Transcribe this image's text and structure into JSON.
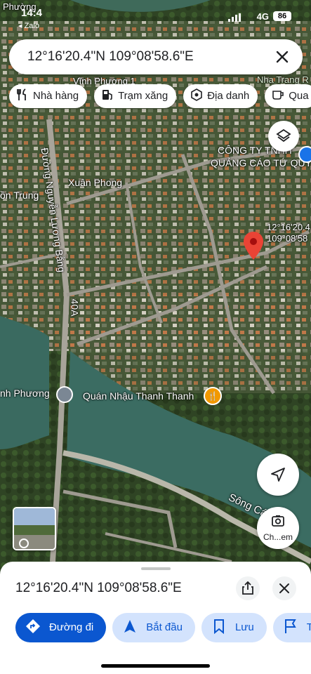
{
  "status_bar": {
    "time": "14:4",
    "back_app": "◂ Zalo",
    "network": "4G",
    "battery": "86"
  },
  "search": {
    "query": "12°16'20.4\"N 109°08'58.6\"E",
    "close_icon": "close-icon"
  },
  "categories": [
    {
      "label": "Nhà hàng",
      "icon": "restaurant-icon"
    },
    {
      "label": "Trạm xăng",
      "icon": "gas-station-icon"
    },
    {
      "label": "Địa danh",
      "icon": "landmark-icon"
    },
    {
      "label": "Qua",
      "icon": "coffee-icon"
    }
  ],
  "map": {
    "labels": {
      "top_left": "Phường",
      "top_street": "Vĩnh Phương 1",
      "top_right": "Nha Trang R",
      "company_1": "CÔNG TY TNHH",
      "company_2": "QUẢNG CÁO TỨ QUÝ",
      "xuan_phong": "Xuân Phong",
      "on_trung": "ồn Trung",
      "street_vertical": "Đường Nguyễn Lương Bằng",
      "road_40a": "40A",
      "vinh_phuong": "nh Phương",
      "restaurant": "Quán Nhậu Thanh Thanh",
      "river": "Sông Cái Nha T"
    },
    "pin_label_1": "12°16'20.4",
    "pin_label_2": "109°08'58",
    "lens_label": "Ch...em"
  },
  "sheet": {
    "coordinates": "12°16'20.4\"N 109°08'58.6\"E",
    "actions": [
      {
        "label": "Đường đi",
        "icon": "directions-icon"
      },
      {
        "label": "Bắt đầu",
        "icon": "navigation-icon"
      },
      {
        "label": "Lưu",
        "icon": "bookmark-icon"
      },
      {
        "label": "T",
        "icon": "flag-icon"
      }
    ]
  },
  "colors": {
    "accent": "#0b57d0",
    "accent_light": "#d3e3fd",
    "pin": "#ea4335"
  }
}
